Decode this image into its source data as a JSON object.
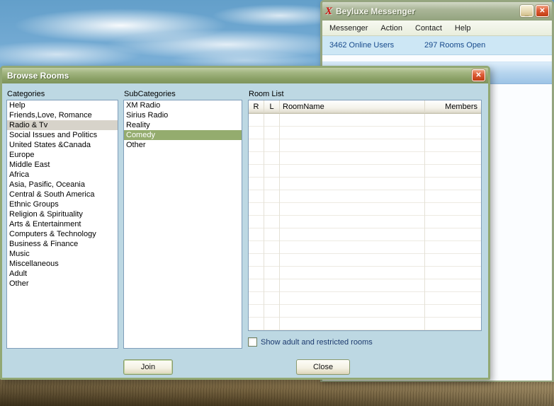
{
  "messenger": {
    "title": "Beyluxe Messenger",
    "icons": {
      "logo": "X",
      "minimize": "_",
      "close": "✕"
    },
    "menu_items": [
      "Messenger",
      "Action",
      "Contact",
      "Help"
    ],
    "status": {
      "online_users": "3462 Online Users",
      "rooms_open": "297 Rooms Open"
    }
  },
  "dialog": {
    "title": "Browse Rooms",
    "icons": {
      "close": "✕"
    },
    "categories": {
      "label": "Categories",
      "items": [
        "Help",
        "Friends,Love, Romance",
        "Radio & Tv",
        "Social Issues and Politics",
        "United States &Canada",
        "Europe",
        "Middle East",
        "Africa",
        "Asia, Pasific, Oceania",
        "Central & South America",
        "Ethnic Groups",
        "Religion & Spirituality",
        "Arts & Entertainment",
        "Computers & Technology",
        "Business & Finance",
        "Music",
        "Miscellaneous",
        "Adult",
        "Other"
      ],
      "selected": "Radio & Tv"
    },
    "subcategories": {
      "label": "SubCategories",
      "items": [
        "XM Radio",
        "Sirius Radio",
        "Reality",
        "Comedy",
        "Other"
      ],
      "selected": "Comedy"
    },
    "room_list": {
      "label": "Room List",
      "columns": [
        "R",
        "L",
        "RoomName",
        "Members"
      ],
      "rows": []
    },
    "show_rooms_checkbox": {
      "label": "Show adult and restricted rooms",
      "checked": false
    },
    "buttons": {
      "join": "Join",
      "close": "Close"
    }
  },
  "colors": {
    "titlebar_olive": "#8aa066",
    "dialog_body": "#bdd8e3",
    "selection_active": "#94ac6e",
    "selection_inactive": "#d7d3ca",
    "status_text": "#174a8c",
    "close_button": "#dd5a35"
  }
}
